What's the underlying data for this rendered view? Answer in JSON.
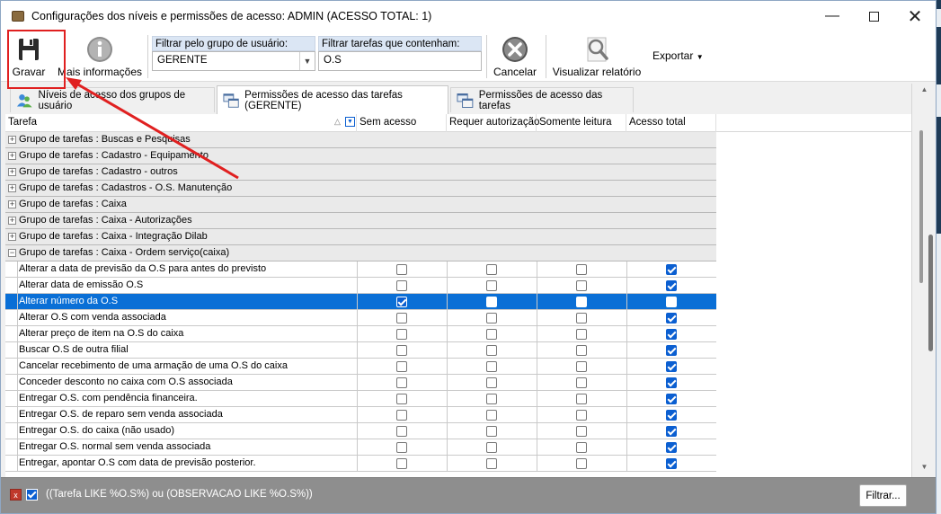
{
  "window": {
    "title": "Configurações dos níveis e permissões de acesso: ADMIN (ACESSO TOTAL: 1)"
  },
  "toolbar": {
    "save_label": "Gravar",
    "info_label": "Mais informações",
    "group_filter": {
      "label": "Filtrar pelo grupo de usuário:",
      "value": "GERENTE"
    },
    "task_filter": {
      "label": "Filtrar tarefas que contenham:",
      "value": "O.S"
    },
    "cancel_label": "Cancelar",
    "report_label": "Visualizar relatório",
    "export_label": "Exportar"
  },
  "tabs": [
    {
      "label": "Níveis de acesso dos grupos de usuário"
    },
    {
      "label": "Permissões de acesso das tarefas (GERENTE)"
    },
    {
      "label": "Permissões de acesso das tarefas"
    }
  ],
  "grid": {
    "columns": [
      "Tarefa",
      "Sem acesso",
      "Requer autorização",
      "Somente leitura",
      "Acesso total"
    ],
    "groups": [
      "Grupo de tarefas : Buscas e Pesquisas",
      "Grupo de tarefas : Cadastro - Equipamento",
      "Grupo de tarefas : Cadastro - outros",
      "Grupo de tarefas : Cadastros - O.S. Manutenção",
      "Grupo de tarefas : Caixa",
      "Grupo de tarefas : Caixa - Autorizações",
      "Grupo de tarefas : Caixa - Integração Dilab",
      "Grupo de tarefas : Caixa - Ordem serviço(caixa)"
    ],
    "tasks": [
      {
        "name": "Alterar a data de previsão da O.S para antes do previsto",
        "checks": [
          false,
          false,
          false,
          true
        ]
      },
      {
        "name": "Alterar data de emissão O.S",
        "checks": [
          false,
          false,
          false,
          true
        ]
      },
      {
        "name": "Alterar número da O.S",
        "checks": [
          true,
          false,
          false,
          false
        ],
        "selected": true
      },
      {
        "name": "Alterar O.S com venda associada",
        "checks": [
          false,
          false,
          false,
          true
        ]
      },
      {
        "name": "Alterar preço de item na O.S do caixa",
        "checks": [
          false,
          false,
          false,
          true
        ]
      },
      {
        "name": "Buscar O.S de outra filial",
        "checks": [
          false,
          false,
          false,
          true
        ]
      },
      {
        "name": "Cancelar recebimento de uma armação de uma O.S do caixa",
        "checks": [
          false,
          false,
          false,
          true
        ]
      },
      {
        "name": "Conceder desconto no caixa com O.S associada",
        "checks": [
          false,
          false,
          false,
          true
        ]
      },
      {
        "name": "Entregar O.S. com pendência financeira.",
        "checks": [
          false,
          false,
          false,
          true
        ]
      },
      {
        "name": "Entregar O.S. de reparo sem venda associada",
        "checks": [
          false,
          false,
          false,
          true
        ]
      },
      {
        "name": "Entregar O.S. do caixa (não usado)",
        "checks": [
          false,
          false,
          false,
          true
        ]
      },
      {
        "name": "Entregar O.S. normal sem venda associada",
        "checks": [
          false,
          false,
          false,
          true
        ]
      },
      {
        "name": "Entregar, apontar O.S com data de previsão posterior.",
        "checks": [
          false,
          false,
          false,
          true
        ]
      }
    ]
  },
  "status": {
    "filter_text": "((Tarefa LIKE %O.S%) ou (OBSERVACAO LIKE %O.S%))",
    "filter_button": "Filtrar..."
  }
}
